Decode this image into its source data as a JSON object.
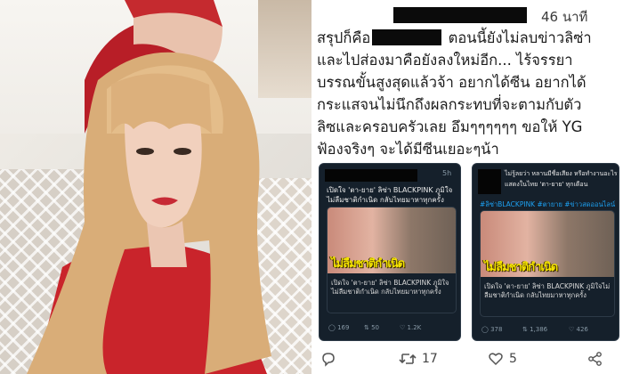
{
  "tweet": {
    "time_ago": "46 นาที",
    "lines": [
      {
        "before": "สรุปก็คือ",
        "after": " ตอนนี้ยังไม่ลบข่าวลิซ่า"
      },
      {
        "text": "และไปส่องมาคือยังลงใหม่อีก... ไร้จรรยา"
      },
      {
        "text": "บรรณขั้นสูงสุดแล้วจ้า อยากได้ซีน อยากได้"
      },
      {
        "text": "กระแสจนไม่นึกถึงผลกระทบที่จะตามกับตัว"
      },
      {
        "text": "ลิซและครอบครัวเลย อึมๆๆๆๆๆๆ ขอให้ YG"
      },
      {
        "text": "ฟ้องจริงๆ จะได้มีซีนเยอะๆน้า"
      }
    ],
    "actions": {
      "reply_icon": "reply-icon",
      "retweet_count": "17",
      "like_count": "5",
      "share_icon": "share-icon"
    }
  },
  "shot1": {
    "time": "5h",
    "headline": "เปิดใจ 'ตา-ยาย' ลิซ่า BLACKPINK ภูมิใจไม่ลืมชาติกำเนิด กลับไทยมาหาทุกครั้ง",
    "card_overlay": "ไม่ลืมชาติกำเนิด",
    "card_caption": "เปิดใจ 'ตา-ยาย' ลิซ่า BLACKPINK ภูมิใจไม่ลืมชาติกำเนิด กลับไทยมาหาทุกครั้ง",
    "replies": "169",
    "retweets": "50",
    "likes": "1.2K"
  },
  "shot2": {
    "line1": "ไม่รู้ลยว่า หลานมีชื่อเสียง หรือทำงานอะไร",
    "line2": "แสดงในไทย 'ตา-ยาย' ทุกเดือน",
    "hashtags": "#ลิซ่าBLACKPINK #ตายาย #ข่าวสดออนไลน์",
    "card_overlay": "ไม่ลืมชาติกำเนิด",
    "card_caption": "เปิดใจ 'ตา-ยาย' ลิซ่า BLACKPINK ภูมิใจไม่ลืมชาติกำเนิด กลับไทยมาหาทุกครั้ง",
    "replies": "378",
    "retweets": "1,386",
    "likes": "426"
  },
  "colors": {
    "background": "#ffffff",
    "text": "#1c1c1c",
    "dark_card": "#15202b",
    "accent_link": "#1da1f2"
  }
}
